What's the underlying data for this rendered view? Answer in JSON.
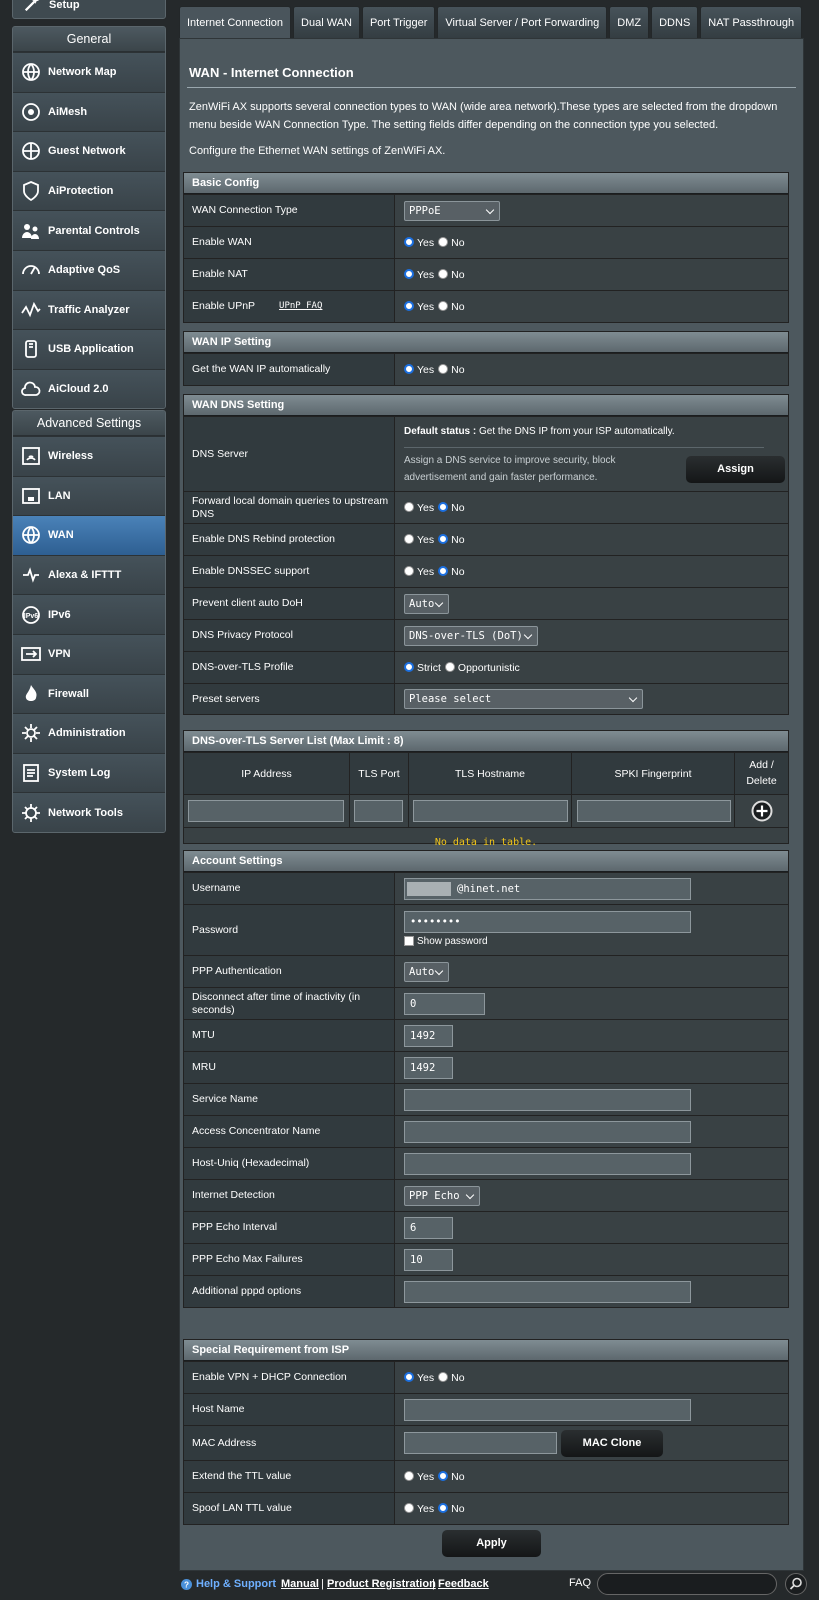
{
  "sidebar": {
    "setup_label": "Setup",
    "general_header": "General",
    "general_items": [
      {
        "label": "Network Map",
        "icon": "network-map-icon"
      },
      {
        "label": "AiMesh",
        "icon": "aimesh-icon"
      },
      {
        "label": "Guest Network",
        "icon": "guest-network-icon"
      },
      {
        "label": "AiProtection",
        "icon": "shield-icon"
      },
      {
        "label": "Parental Controls",
        "icon": "parental-controls-icon"
      },
      {
        "label": "Adaptive QoS",
        "icon": "gauge-icon"
      },
      {
        "label": "Traffic Analyzer",
        "icon": "traffic-analyzer-icon"
      },
      {
        "label": "USB Application",
        "icon": "usb-icon"
      },
      {
        "label": "AiCloud 2.0",
        "icon": "cloud-icon"
      }
    ],
    "advanced_header": "Advanced Settings",
    "advanced_items": [
      {
        "label": "Wireless",
        "icon": "wireless-icon"
      },
      {
        "label": "LAN",
        "icon": "lan-icon"
      },
      {
        "label": "WAN",
        "icon": "globe-icon",
        "active": true
      },
      {
        "label": "Alexa & IFTTT",
        "icon": "alexa-icon"
      },
      {
        "label": "IPv6",
        "icon": "ipv6-icon"
      },
      {
        "label": "VPN",
        "icon": "vpn-icon"
      },
      {
        "label": "Firewall",
        "icon": "firewall-icon"
      },
      {
        "label": "Administration",
        "icon": "admin-gear-icon"
      },
      {
        "label": "System Log",
        "icon": "system-log-icon"
      },
      {
        "label": "Network Tools",
        "icon": "network-tools-icon"
      }
    ]
  },
  "tabs": [
    "Internet Connection",
    "Dual WAN",
    "Port Trigger",
    "Virtual Server / Port Forwarding",
    "DMZ",
    "DDNS",
    "NAT Passthrough"
  ],
  "page": {
    "title": "WAN - Internet Connection",
    "desc1": "ZenWiFi AX supports several connection types to WAN (wide area network).These types are selected from the dropdown menu beside WAN Connection Type. The setting fields differ depending on the connection type you selected.",
    "desc2": "Configure the Ethernet WAN settings of ZenWiFi AX."
  },
  "common": {
    "yes": "Yes",
    "no": "No"
  },
  "basic": {
    "header": "Basic Config",
    "conn_type_label": "WAN Connection Type",
    "conn_type_value": "PPPoE",
    "enable_wan_label": "Enable WAN",
    "enable_nat_label": "Enable NAT",
    "enable_upnp_label": "Enable UPnP",
    "upnp_faq": "UPnP  FAQ"
  },
  "wanip": {
    "header": "WAN IP Setting",
    "auto_label": "Get the WAN IP automatically"
  },
  "dns": {
    "header": "WAN DNS Setting",
    "server_label": "DNS Server",
    "default_status_bold": "Default status :",
    "default_status_text": " Get the DNS IP from your ISP automatically.",
    "assign_desc": "Assign a DNS service to improve security, block advertisement and gain faster performance.",
    "assign_btn": "Assign",
    "forward_label": "Forward local domain queries to upstream DNS",
    "rebind_label": "Enable DNS Rebind protection",
    "dnssec_label": "Enable DNSSEC support",
    "doh_label": "Prevent client auto DoH",
    "doh_value": "Auto",
    "privacy_label": "DNS Privacy Protocol",
    "privacy_value": "DNS-over-TLS (DoT)",
    "dot_profile_label": "DNS-over-TLS Profile",
    "strict": "Strict",
    "opportunistic": "Opportunistic",
    "preset_label": "Preset servers",
    "preset_value": "Please select"
  },
  "dot": {
    "header": "DNS-over-TLS Server List (Max Limit : 8)",
    "columns": [
      "IP Address",
      "TLS Port",
      "TLS Hostname",
      "SPKI Fingerprint",
      "Add / Delete"
    ],
    "empty": "No data in table."
  },
  "account": {
    "header": "Account Settings",
    "username_label": "Username",
    "username_value": "@hinet.net",
    "password_label": "Password",
    "password_value": "••••••••",
    "show_password": "Show password",
    "ppp_auth_label": "PPP Authentication",
    "ppp_auth_value": "Auto",
    "idle_label": "Disconnect after time of inactivity (in seconds)",
    "idle_value": "0",
    "mtu_label": "MTU",
    "mtu_value": "1492",
    "mru_label": "MRU",
    "mru_value": "1492",
    "service_label": "Service Name",
    "ac_label": "Access Concentrator Name",
    "hostuniq_label": "Host-Uniq (Hexadecimal)",
    "detect_label": "Internet Detection",
    "detect_value": "PPP Echo",
    "echo_interval_label": "PPP Echo Interval",
    "echo_interval_value": "6",
    "echo_fail_label": "PPP Echo Max Failures",
    "echo_fail_value": "10",
    "pppd_label": "Additional pppd options"
  },
  "special": {
    "header": "Special Requirement from ISP",
    "vpn_dhcp_label": "Enable VPN + DHCP Connection",
    "hostname_label": "Host Name",
    "mac_label": "MAC Address",
    "mac_clone": "MAC Clone",
    "ttl_label": "Extend the TTL value",
    "spoof_label": "Spoof LAN TTL value"
  },
  "apply": "Apply",
  "footer": {
    "help": "Help & Support",
    "manual": "Manual",
    "sep": "|",
    "product_reg": "Product Registration",
    "feedback": "Feedback",
    "faq": "FAQ"
  },
  "colors": {
    "accent": "#1b6fe0",
    "active_item": "#3a6fa3",
    "empty_text": "#f0c419"
  }
}
